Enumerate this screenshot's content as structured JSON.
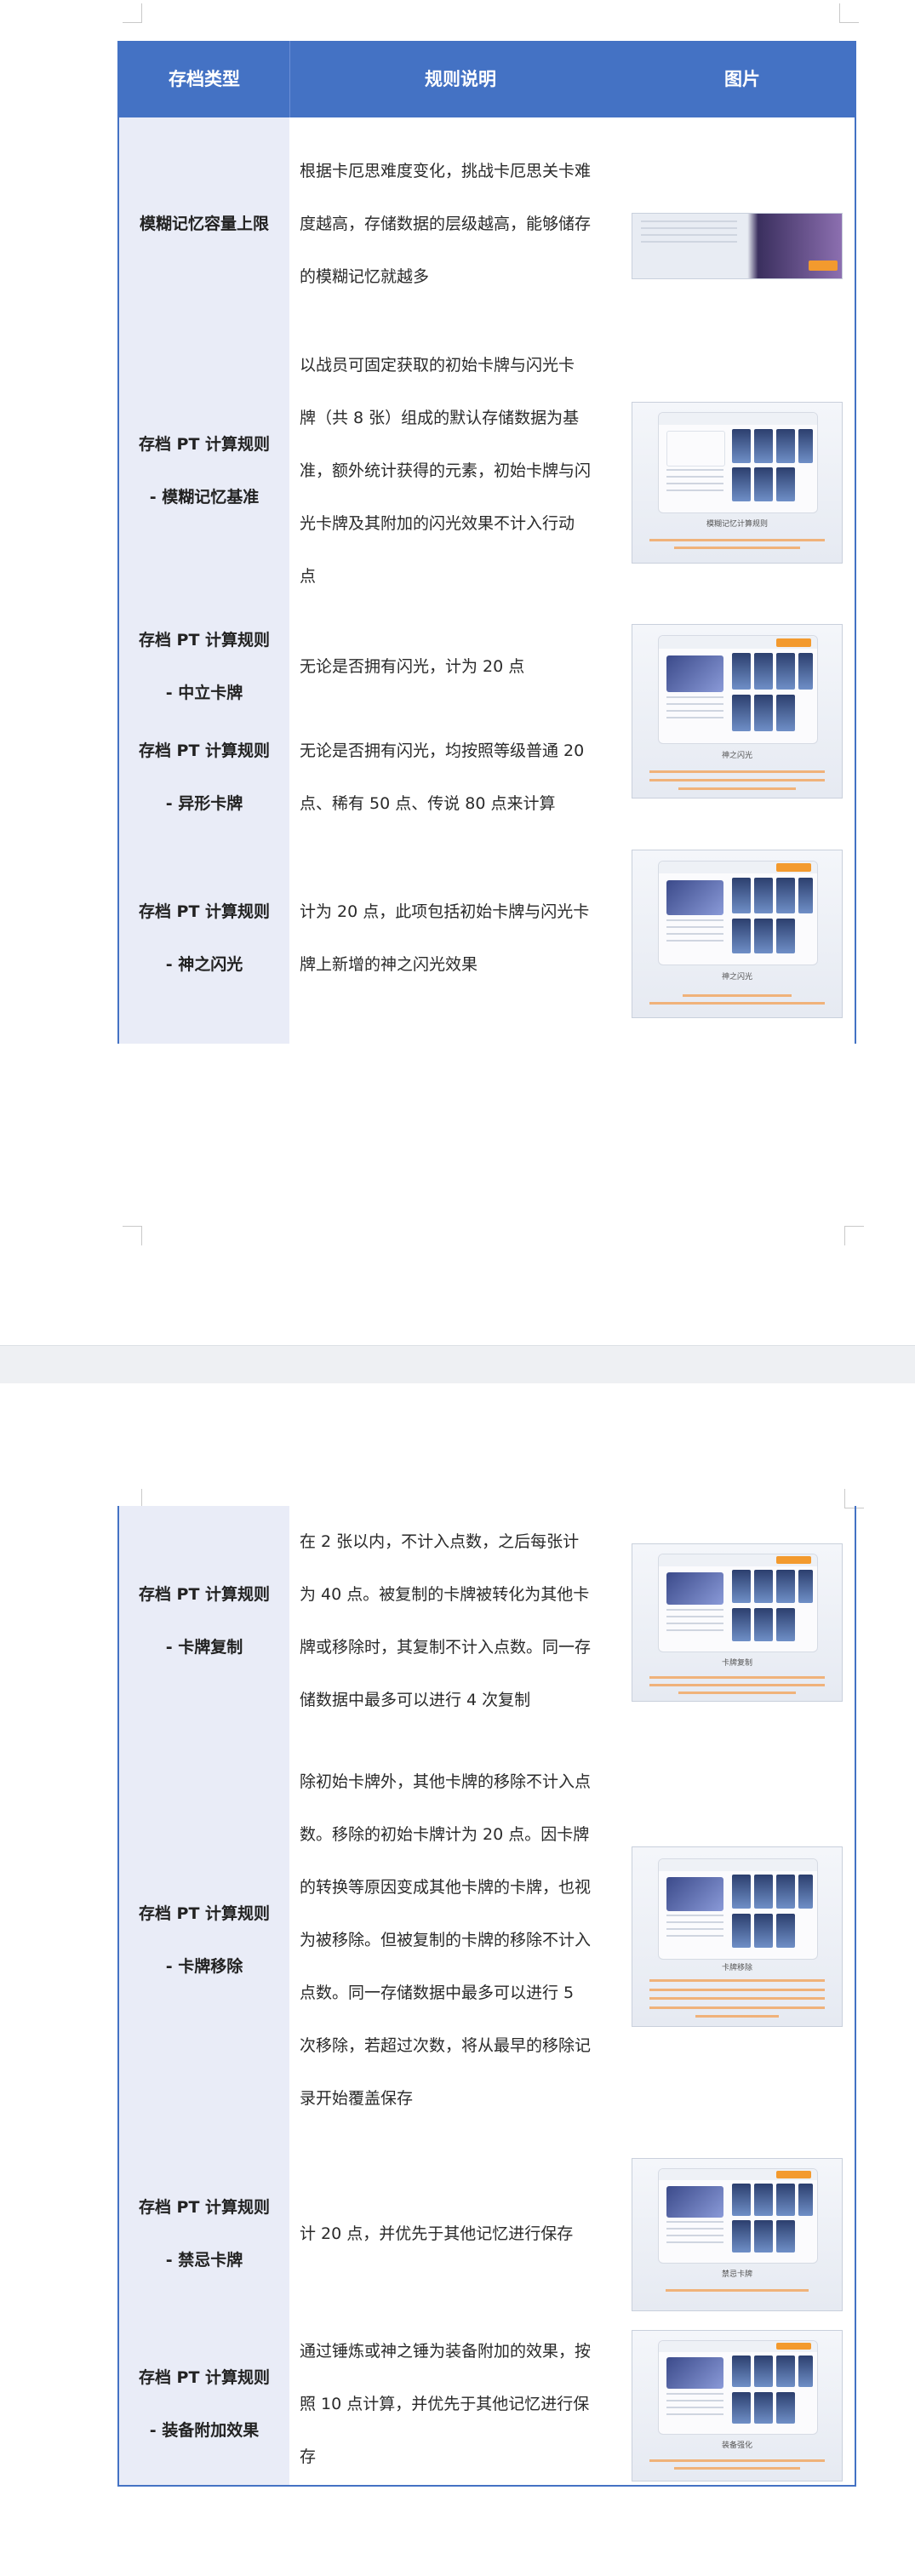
{
  "header": {
    "col_type": "存档类型",
    "col_rule": "规则说明",
    "col_image": "图片"
  },
  "rows_page1": [
    {
      "type_lines": [
        "模糊记忆容量上限"
      ],
      "desc_lines": [
        "根据卡厄思难度变化，挑战卡厄思关卡难",
        "度越高，存储数据的层级越高，能够储存",
        "的模糊记忆就越多"
      ]
    },
    {
      "type_lines": [
        "存档 PT 计算规则",
        "- 模糊记忆基准"
      ],
      "desc_lines": [
        "以战员可固定获取的初始卡牌与闪光卡",
        "牌（共 8 张）组成的默认存储数据为基",
        "准，额外统计获得的元素，初始卡牌与闪",
        "光卡牌及其附加的闪光效果不计入行动",
        "点"
      ]
    },
    {
      "type_lines": [
        "存档 PT 计算规则",
        "- 中立卡牌"
      ],
      "desc_lines": [
        "无论是否拥有闪光，计为 20 点"
      ]
    },
    {
      "type_lines": [
        "存档 PT 计算规则",
        "- 异形卡牌"
      ],
      "desc_lines": [
        "无论是否拥有闪光，均按照等级普通 20",
        "点、稀有 50 点、传说 80 点来计算"
      ]
    },
    {
      "type_lines": [
        "存档 PT 计算规则",
        "- 神之闪光"
      ],
      "desc_lines": [
        "计为 20 点，此项包括初始卡牌与闪光卡",
        "牌上新增的神之闪光效果"
      ]
    }
  ],
  "rows_page2": [
    {
      "type_lines": [
        "存档 PT 计算规则",
        "- 卡牌复制"
      ],
      "desc_lines": [
        "在 2 张以内，不计入点数，之后每张计",
        "为 40 点。被复制的卡牌被转化为其他卡",
        "牌或移除时，其复制不计入点数。同一存",
        "储数据中最多可以进行 4 次复制"
      ]
    },
    {
      "type_lines": [
        "存档 PT 计算规则",
        "- 卡牌移除"
      ],
      "desc_lines": [
        "除初始卡牌外，其他卡牌的移除不计入点",
        "数。移除的初始卡牌计为 20 点。因卡牌",
        "的转换等原因变成其他卡牌的卡牌，也视",
        "为被移除。但被复制的卡牌的移除不计入",
        "点数。同一存储数据中最多可以进行 5",
        "次移除，若超过次数，将从最早的移除记",
        "录开始覆盖保存"
      ]
    },
    {
      "type_lines": [
        "存档 PT 计算规则",
        "- 禁忌卡牌"
      ],
      "desc_lines": [
        "计 20 点，并优先于其他记忆进行保存"
      ]
    },
    {
      "type_lines": [
        "存档 PT 计算规则",
        "- 装备附加效果"
      ],
      "desc_lines": [
        "通过锤炼或神之锤为装备附加的效果，按",
        "照 10 点计算，并优先于其他记忆进行保",
        "存"
      ]
    }
  ],
  "thumb_captions": {
    "r2": "模糊记忆计算规则",
    "r3": "神之闪光",
    "r5": "神之闪光",
    "p2r1": "卡牌复制",
    "p2r2": "卡牌移除",
    "p2r3": "禁忌卡牌",
    "p2r4": "装备强化"
  },
  "colors": {
    "header_bg": "#4472c4",
    "type_col_bg": "#e9ecf7",
    "accent_orange": "#f39a2e"
  }
}
